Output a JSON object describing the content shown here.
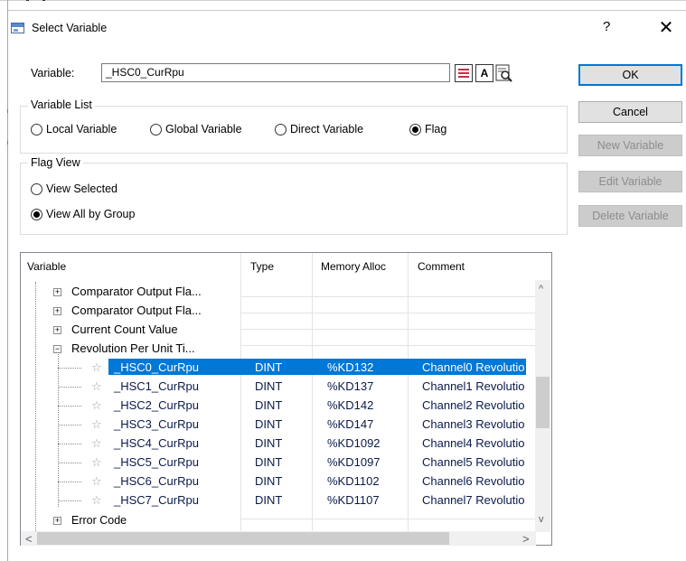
{
  "dialog": {
    "title": "Select Variable",
    "help_label": "?",
    "close_label": "✕"
  },
  "variable": {
    "label": "Variable:",
    "value": "_HSC0_CurRpu",
    "tool_a_label": "A"
  },
  "variable_list": {
    "title": "Variable List",
    "options": [
      "Local Variable",
      "Global Variable",
      "Direct Variable",
      "Flag"
    ],
    "selected": "Flag"
  },
  "flag_view": {
    "title": "Flag View",
    "options": [
      "View Selected",
      "View All by Group"
    ],
    "selected": "View All by Group"
  },
  "buttons": {
    "ok": "OK",
    "cancel": "Cancel",
    "new_variable": "New Variable",
    "edit_variable": "Edit Variable",
    "delete_variable": "Delete Variable"
  },
  "table": {
    "columns": [
      "Variable",
      "Type",
      "Memory Alloc",
      "Comment"
    ],
    "groups": [
      {
        "label": "Comparator Output Fla...",
        "expanded": false
      },
      {
        "label": "Comparator Output Fla...",
        "expanded": false
      },
      {
        "label": "Current Count Value",
        "expanded": false
      },
      {
        "label": "Revolution Per Unit Ti...",
        "expanded": true
      }
    ],
    "rows": [
      {
        "name": "_HSC0_CurRpu",
        "type": "DINT",
        "mem": "%KD132",
        "comment": "Channel0 Revolutio",
        "selected": true
      },
      {
        "name": "_HSC1_CurRpu",
        "type": "DINT",
        "mem": "%KD137",
        "comment": "Channel1 Revolutio",
        "selected": false
      },
      {
        "name": "_HSC2_CurRpu",
        "type": "DINT",
        "mem": "%KD142",
        "comment": "Channel2 Revolutio",
        "selected": false
      },
      {
        "name": "_HSC3_CurRpu",
        "type": "DINT",
        "mem": "%KD147",
        "comment": "Channel3 Revolutio",
        "selected": false
      },
      {
        "name": "_HSC4_CurRpu",
        "type": "DINT",
        "mem": "%KD1092",
        "comment": "Channel4 Revolutio",
        "selected": false
      },
      {
        "name": "_HSC5_CurRpu",
        "type": "DINT",
        "mem": "%KD1097",
        "comment": "Channel5 Revolutio",
        "selected": false
      },
      {
        "name": "_HSC6_CurRpu",
        "type": "DINT",
        "mem": "%KD1102",
        "comment": "Channel6 Revolutio",
        "selected": false
      },
      {
        "name": "_HSC7_CurRpu",
        "type": "DINT",
        "mem": "%KD1107",
        "comment": "Channel7 Revolutio",
        "selected": false
      }
    ],
    "trailing_group": {
      "label": "Error Code",
      "expanded": false
    }
  },
  "scroll": {
    "up": "^",
    "down": "v",
    "left": "<",
    "right": ">"
  },
  "icons": {
    "title": "window-icon",
    "tool_1": "variable-list-icon",
    "tool_2": "text-a-icon",
    "tool_3": "search-icon",
    "row": "star-icon"
  },
  "colors": {
    "selection": "#0078d7",
    "primary_border": "#0078d7",
    "disabled_bg": "#cccccc"
  }
}
